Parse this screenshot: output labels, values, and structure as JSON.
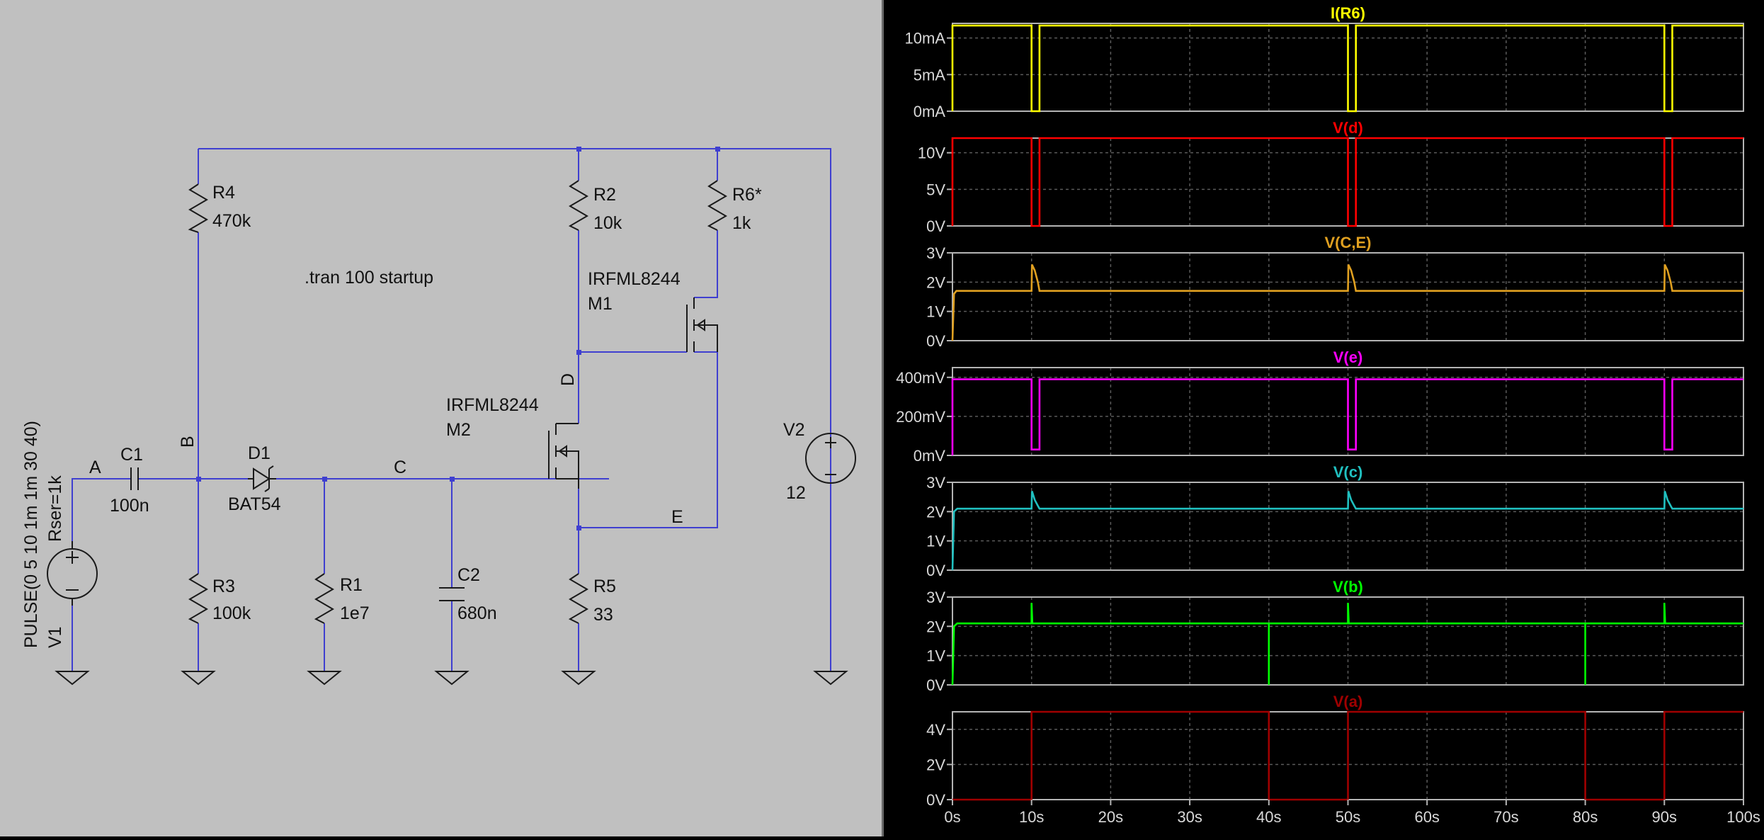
{
  "schematic": {
    "directive": ".tran 100 startup",
    "components": {
      "V1": {
        "name": "V1",
        "value": "PULSE(0 5 10 1m 1m 30 40)",
        "extra": "Rser=1k"
      },
      "V2": {
        "name": "V2",
        "value": "12"
      },
      "C1": {
        "name": "C1",
        "value": "100n"
      },
      "C2": {
        "name": "C2",
        "value": "680n"
      },
      "D1": {
        "name": "D1",
        "value": "BAT54"
      },
      "R1": {
        "name": "R1",
        "value": "1e7"
      },
      "R2": {
        "name": "R2",
        "value": "10k"
      },
      "R3": {
        "name": "R3",
        "value": "100k"
      },
      "R4": {
        "name": "R4",
        "value": "470k"
      },
      "R5": {
        "name": "R5",
        "value": "33"
      },
      "R6": {
        "name": "R6*",
        "value": "1k"
      },
      "M1": {
        "name": "M1",
        "value": "IRFML8244"
      },
      "M2": {
        "name": "M2",
        "value": "IRFML8244"
      }
    },
    "net_labels": {
      "A": "A",
      "B": "B",
      "C": "C",
      "D": "D",
      "E": "E"
    }
  },
  "colors": {
    "schematic_bg": "#c0c0c0",
    "wire": "#3f3fd0",
    "component": "#1a1a1a",
    "plot_bg": "#000000",
    "plot_border": "#b4b4b4",
    "grid": "#5a5a5a"
  },
  "chart_data": [
    {
      "type": "line",
      "title": "I(R6)",
      "color": "#ffff00",
      "ylim": [
        0,
        12
      ],
      "yticks": [
        0,
        5,
        10
      ],
      "yticklabels": [
        "0mA",
        "5mA",
        "10mA"
      ],
      "xlim": [
        0,
        100
      ],
      "series": [
        {
          "name": "I(R6)",
          "x": [
            0,
            0,
            10,
            10,
            11,
            11,
            50,
            50,
            51,
            51,
            90,
            90,
            91,
            91,
            100
          ],
          "y": [
            0,
            11.7,
            11.7,
            0,
            0,
            11.7,
            11.7,
            0,
            0,
            11.7,
            11.7,
            0,
            0,
            11.7,
            11.7
          ]
        }
      ]
    },
    {
      "type": "line",
      "title": "V(d)",
      "color": "#ff0000",
      "ylim": [
        0,
        12
      ],
      "yticks": [
        0,
        5,
        10
      ],
      "yticklabels": [
        "0V",
        "5V",
        "10V"
      ],
      "xlim": [
        0,
        100
      ],
      "series": [
        {
          "name": "V(d)",
          "x": [
            0,
            0,
            10,
            10,
            11,
            11,
            50,
            50,
            51,
            51,
            90,
            90,
            91,
            91,
            100
          ],
          "y": [
            0,
            12,
            12,
            0,
            0,
            12,
            12,
            0,
            0,
            12,
            12,
            0,
            0,
            12,
            12
          ]
        }
      ]
    },
    {
      "type": "line",
      "title": "V(C,E)",
      "color": "#e0a020",
      "ylim": [
        0,
        3
      ],
      "yticks": [
        0,
        1,
        2,
        3
      ],
      "yticklabels": [
        "0V",
        "1V",
        "2V",
        "3V"
      ],
      "xlim": [
        0,
        100
      ],
      "series": [
        {
          "name": "V(C,E)",
          "x": [
            0,
            0.2,
            0.5,
            10,
            10.05,
            10.4,
            10.8,
            11,
            50,
            50.05,
            50.4,
            50.8,
            51,
            90,
            90.05,
            90.4,
            90.8,
            91,
            100
          ],
          "y": [
            0,
            1.6,
            1.7,
            1.7,
            2.6,
            2.4,
            2.0,
            1.7,
            1.7,
            2.6,
            2.4,
            2.0,
            1.7,
            1.7,
            2.6,
            2.4,
            2.0,
            1.7,
            1.7
          ]
        }
      ]
    },
    {
      "type": "line",
      "title": "V(e)",
      "color": "#ff00ff",
      "ylim": [
        0,
        0.45
      ],
      "yticks": [
        0,
        0.2,
        0.4
      ],
      "yticklabels": [
        "0mV",
        "200mV",
        "400mV"
      ],
      "xlim": [
        0,
        100
      ],
      "series": [
        {
          "name": "V(e)",
          "x": [
            0,
            0,
            10,
            10,
            11,
            11,
            50,
            50,
            51,
            51,
            90,
            90,
            91,
            91,
            100
          ],
          "y": [
            0,
            0.39,
            0.39,
            0.03,
            0.03,
            0.39,
            0.39,
            0.03,
            0.03,
            0.39,
            0.39,
            0.03,
            0.03,
            0.39,
            0.39
          ]
        }
      ]
    },
    {
      "type": "line",
      "title": "V(c)",
      "color": "#20c0c0",
      "ylim": [
        0,
        3
      ],
      "yticks": [
        0,
        1,
        2,
        3
      ],
      "yticklabels": [
        "0V",
        "1V",
        "2V",
        "3V"
      ],
      "xlim": [
        0,
        100
      ],
      "series": [
        {
          "name": "V(c)",
          "x": [
            0,
            0.2,
            0.6,
            10,
            10.05,
            10.4,
            10.8,
            11,
            50,
            50.05,
            50.4,
            50.8,
            51,
            90,
            90.05,
            90.4,
            90.8,
            91,
            100
          ],
          "y": [
            0,
            2.0,
            2.1,
            2.1,
            2.7,
            2.4,
            2.2,
            2.1,
            2.1,
            2.7,
            2.4,
            2.2,
            2.1,
            2.1,
            2.7,
            2.4,
            2.2,
            2.1,
            2.1
          ]
        }
      ]
    },
    {
      "type": "line",
      "title": "V(b)",
      "color": "#00ff00",
      "ylim": [
        0,
        3
      ],
      "yticks": [
        0,
        1,
        2,
        3
      ],
      "yticklabels": [
        "0V",
        "1V",
        "2V",
        "3V"
      ],
      "xlim": [
        0,
        100
      ],
      "series": [
        {
          "name": "V(b)",
          "x": [
            0,
            0.2,
            0.6,
            10,
            10,
            10.1,
            40,
            40,
            40,
            50,
            50,
            50.1,
            80,
            80,
            80,
            90,
            90,
            90.1,
            100
          ],
          "y": [
            0,
            2.0,
            2.1,
            2.1,
            2.8,
            2.1,
            2.1,
            0,
            2.1,
            2.1,
            2.8,
            2.1,
            2.1,
            0,
            2.1,
            2.1,
            2.8,
            2.1,
            2.1
          ]
        }
      ]
    },
    {
      "type": "line",
      "title": "V(a)",
      "color": "#a00000",
      "ylim": [
        0,
        5
      ],
      "yticks": [
        0,
        2,
        4
      ],
      "yticklabels": [
        "0V",
        "2V",
        "4V"
      ],
      "xlim": [
        0,
        100
      ],
      "xticks": [
        0,
        10,
        20,
        30,
        40,
        50,
        60,
        70,
        80,
        90,
        100
      ],
      "xticklabels": [
        "0s",
        "10s",
        "20s",
        "30s",
        "40s",
        "50s",
        "60s",
        "70s",
        "80s",
        "90s",
        "100s"
      ],
      "series": [
        {
          "name": "V(a)",
          "x": [
            0,
            10,
            10,
            40,
            40,
            50,
            50,
            80,
            80,
            90,
            90,
            100
          ],
          "y": [
            0,
            0,
            5,
            5,
            0,
            0,
            5,
            5,
            0,
            0,
            5,
            5
          ]
        }
      ]
    }
  ]
}
